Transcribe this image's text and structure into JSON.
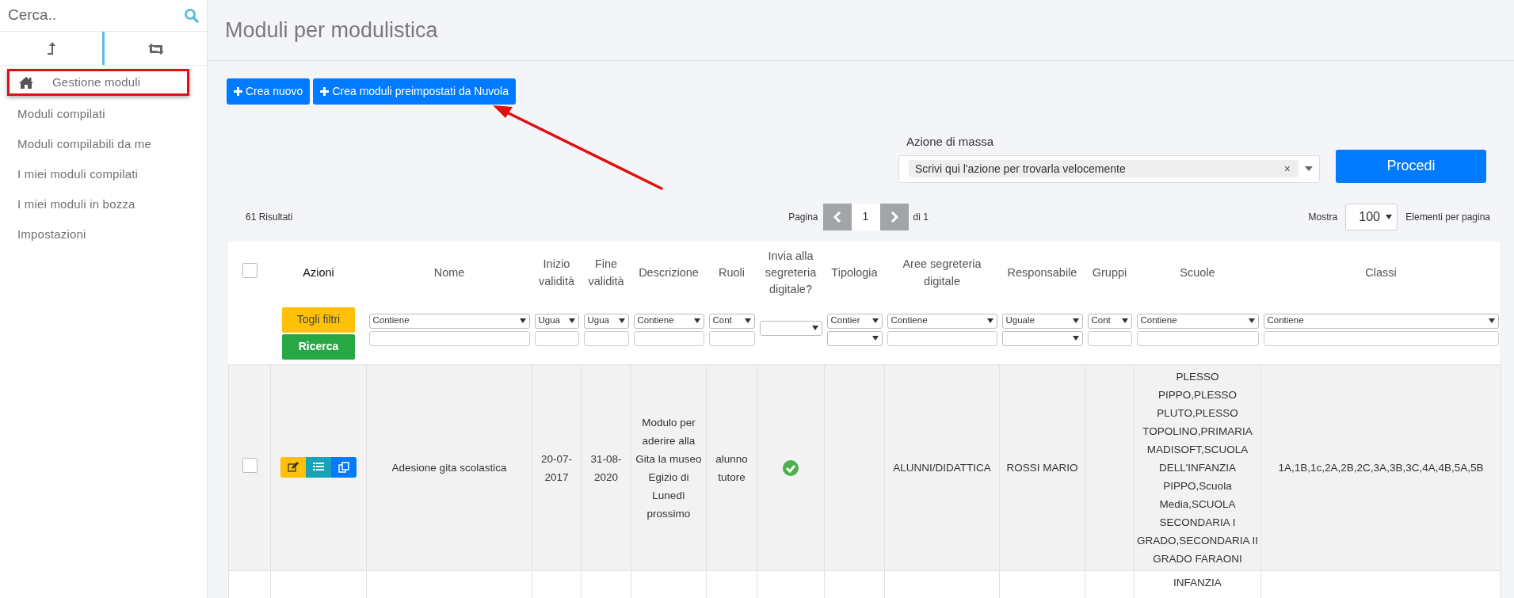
{
  "sidebar": {
    "search": {
      "placeholder": "Cerca.."
    },
    "tabs": [
      {
        "selected": true
      },
      {
        "selected": false
      }
    ],
    "items": [
      {
        "label": "Gestione moduli",
        "kind": "home",
        "highlighted": true
      },
      {
        "label": "Moduli compilati",
        "kind": "link",
        "highlighted": false
      },
      {
        "label": "Moduli compilabili da me",
        "kind": "link",
        "highlighted": false
      },
      {
        "label": "I miei moduli compilati",
        "kind": "link",
        "highlighted": false
      },
      {
        "label": "I miei moduli in bozza",
        "kind": "link",
        "highlighted": false
      },
      {
        "label": "Impostazioni",
        "kind": "link",
        "highlighted": false
      }
    ]
  },
  "page": {
    "title": "Moduli per modulistica"
  },
  "actions": [
    {
      "label": "Crea nuovo"
    },
    {
      "label": "Crea moduli preimpostati da Nuvola"
    }
  ],
  "annotation_arrow": true,
  "mass_action": {
    "label": "Azione di massa",
    "value": "Scrivi qui l'azione per trovarla velocemente",
    "clear": "×",
    "button": "Procedi"
  },
  "results": "61 Risultati",
  "pagination": {
    "label": "Pagina",
    "page": "1",
    "total": "di 1"
  },
  "page_size": {
    "label": "Mostra",
    "value": "100",
    "suffix": "Elementi per pagina"
  },
  "table": {
    "select_all": {
      "checked": false
    },
    "columns": [
      {
        "label": "Azioni",
        "filter": {
          "kind": "buttons",
          "buttons": [
            "Togli filtri",
            "Ricerca"
          ]
        }
      },
      {
        "label": "Nome",
        "filter": {
          "kind": "select-input",
          "select": "Contiene"
        }
      },
      {
        "label": "Inizio validità",
        "filter": {
          "kind": "select-input",
          "select": "Ugua"
        }
      },
      {
        "label": "Fine validità",
        "filter": {
          "kind": "select-input",
          "select": "Ugua"
        }
      },
      {
        "label": "Descrizione",
        "filter": {
          "kind": "select-input",
          "select": "Contiene"
        }
      },
      {
        "label": "Ruoli",
        "filter": {
          "kind": "select-input",
          "select": "Cont"
        }
      },
      {
        "label": "Invia alla segreteria digitale?",
        "filter": {
          "kind": "select"
        }
      },
      {
        "label": "Tipologia",
        "filter": {
          "kind": "select-select",
          "select": "Contier"
        }
      },
      {
        "label": "Aree segreteria digitale",
        "filter": {
          "kind": "select-input",
          "select": "Contiene"
        }
      },
      {
        "label": "Responsabile",
        "filter": {
          "kind": "select-select",
          "select": "Uguale"
        }
      },
      {
        "label": "Gruppi",
        "filter": {
          "kind": "select-input",
          "select": "Cont"
        }
      },
      {
        "label": "Scuole",
        "filter": {
          "kind": "select-input",
          "select": "Contiene"
        }
      },
      {
        "label": "Classi",
        "filter": {
          "kind": "select-input",
          "select": "Contiene"
        }
      }
    ],
    "rows": [
      {
        "checked": false,
        "cells": [
          {
            "kind": "actions"
          },
          {
            "kind": "text",
            "text": "Adesione gita scolastica"
          },
          {
            "kind": "text",
            "text": "20-07-2017"
          },
          {
            "kind": "text",
            "text": "31-08-2020"
          },
          {
            "kind": "text",
            "text": "Modulo per aderire alla Gita la museo Egizio di Lunedì prossimo"
          },
          {
            "kind": "text",
            "text": "alunno tutore"
          },
          {
            "kind": "sent",
            "on": true
          },
          {
            "kind": "empty"
          },
          {
            "kind": "text",
            "text": "ALUNNI/DIDATTICA"
          },
          {
            "kind": "text",
            "text": "ROSSI MARIO"
          },
          {
            "kind": "empty"
          },
          {
            "kind": "text",
            "text": "PLESSO PIPPO,PLESSO PLUTO,PLESSO TOPOLINO,PRIMARIA MADISOFT,SCUOLA DELL'INFANZIA PIPPO,Scuola Media,SCUOLA SECONDARIA I GRADO,SECONDARIA II GRADO FARAONI"
          },
          {
            "kind": "text",
            "text": "1A,1B,1c,2A,2B,2C,3A,3B,3C,4A,4B,5A,5B"
          }
        ]
      },
      {
        "cells": [
          {
            "kind": "empty"
          },
          {
            "kind": "empty"
          },
          {
            "kind": "empty"
          },
          {
            "kind": "empty"
          },
          {
            "kind": "empty"
          },
          {
            "kind": "empty"
          },
          {
            "kind": "empty"
          },
          {
            "kind": "empty"
          },
          {
            "kind": "empty"
          },
          {
            "kind": "empty"
          },
          {
            "kind": "empty"
          },
          {
            "kind": "text",
            "text": "INFANZIA"
          },
          {
            "kind": "empty"
          }
        ]
      }
    ]
  }
}
